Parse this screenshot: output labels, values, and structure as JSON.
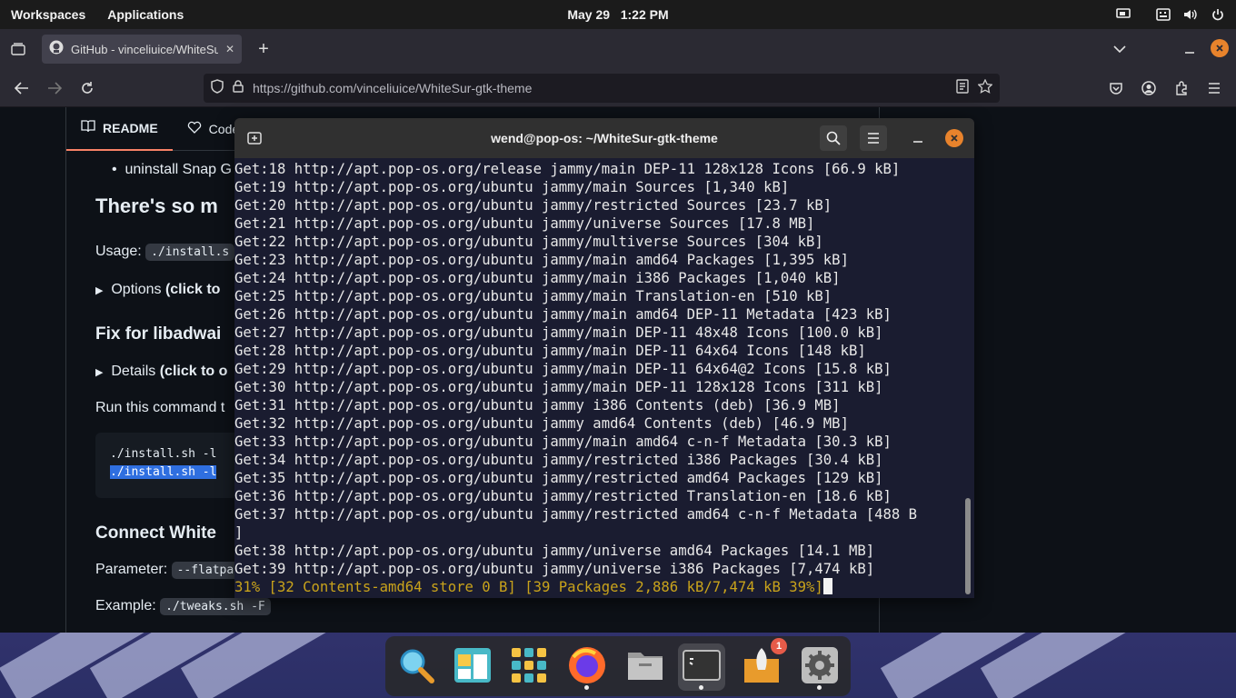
{
  "topbar": {
    "workspaces": "Workspaces",
    "applications": "Applications",
    "date": "May 29",
    "time": "1:22 PM"
  },
  "browser": {
    "tab_title": "GitHub - vinceliuice/WhiteSur-gtk-theme",
    "new_tab": "+",
    "url": "https://github.com/vinceliuice/WhiteSur-gtk-theme",
    "close_label": "✕"
  },
  "readme": {
    "tabs": [
      "README",
      "Code"
    ],
    "bullet": "uninstall Snap G",
    "heading1": "There's so m",
    "usage_label": "Usage:",
    "usage_code": "./install.s",
    "options_label": "Options",
    "options_bold": "(click to",
    "heading2": "Fix for libadwai",
    "details_label": "Details",
    "details_bold": "(click to o",
    "run_text": "Run this command t",
    "pre_line1": "./install.sh -l",
    "pre_line2": "./install.sh -l ",
    "heading3": "Connect White",
    "param_label": "Parameter:",
    "param_code": "--flatpa",
    "example_label": "Example:",
    "example_code": "./tweaks.sh -F"
  },
  "terminal": {
    "title": "wend@pop-os: ~/WhiteSur-gtk-theme",
    "lines": [
      "Get:18 http://apt.pop-os.org/release jammy/main DEP-11 128x128 Icons [66.9 kB]",
      "Get:19 http://apt.pop-os.org/ubuntu jammy/main Sources [1,340 kB]",
      "Get:20 http://apt.pop-os.org/ubuntu jammy/restricted Sources [23.7 kB]",
      "Get:21 http://apt.pop-os.org/ubuntu jammy/universe Sources [17.8 MB]",
      "Get:22 http://apt.pop-os.org/ubuntu jammy/multiverse Sources [304 kB]",
      "Get:23 http://apt.pop-os.org/ubuntu jammy/main amd64 Packages [1,395 kB]",
      "Get:24 http://apt.pop-os.org/ubuntu jammy/main i386 Packages [1,040 kB]",
      "Get:25 http://apt.pop-os.org/ubuntu jammy/main Translation-en [510 kB]",
      "Get:26 http://apt.pop-os.org/ubuntu jammy/main amd64 DEP-11 Metadata [423 kB]",
      "Get:27 http://apt.pop-os.org/ubuntu jammy/main DEP-11 48x48 Icons [100.0 kB]",
      "Get:28 http://apt.pop-os.org/ubuntu jammy/main DEP-11 64x64 Icons [148 kB]",
      "Get:29 http://apt.pop-os.org/ubuntu jammy/main DEP-11 64x64@2 Icons [15.8 kB]",
      "Get:30 http://apt.pop-os.org/ubuntu jammy/main DEP-11 128x128 Icons [311 kB]",
      "Get:31 http://apt.pop-os.org/ubuntu jammy i386 Contents (deb) [36.9 MB]",
      "Get:32 http://apt.pop-os.org/ubuntu jammy amd64 Contents (deb) [46.9 MB]",
      "Get:33 http://apt.pop-os.org/ubuntu jammy/main amd64 c-n-f Metadata [30.3 kB]",
      "Get:34 http://apt.pop-os.org/ubuntu jammy/restricted i386 Packages [30.4 kB]",
      "Get:35 http://apt.pop-os.org/ubuntu jammy/restricted amd64 Packages [129 kB]",
      "Get:36 http://apt.pop-os.org/ubuntu jammy/restricted Translation-en [18.6 kB]",
      "Get:37 http://apt.pop-os.org/ubuntu jammy/restricted amd64 c-n-f Metadata [488 B",
      "]",
      "Get:38 http://apt.pop-os.org/ubuntu jammy/universe amd64 Packages [14.1 MB]",
      "Get:39 http://apt.pop-os.org/ubuntu jammy/universe i386 Packages [7,474 kB]"
    ],
    "progress": "31% [32 Contents-amd64 store 0 B] [39 Packages 2,886 kB/7,474 kB 39%]"
  },
  "dock": {
    "items": [
      "search-app",
      "files-app",
      "app-library",
      "firefox",
      "file-manager",
      "terminal",
      "pop-shop",
      "settings"
    ],
    "shop_badge": "1"
  },
  "colors": {
    "terminal_bg": "#1a1c30",
    "progress_text": "#c9a31b",
    "close_button": "#e8832c",
    "github_bg": "#0d1117"
  }
}
